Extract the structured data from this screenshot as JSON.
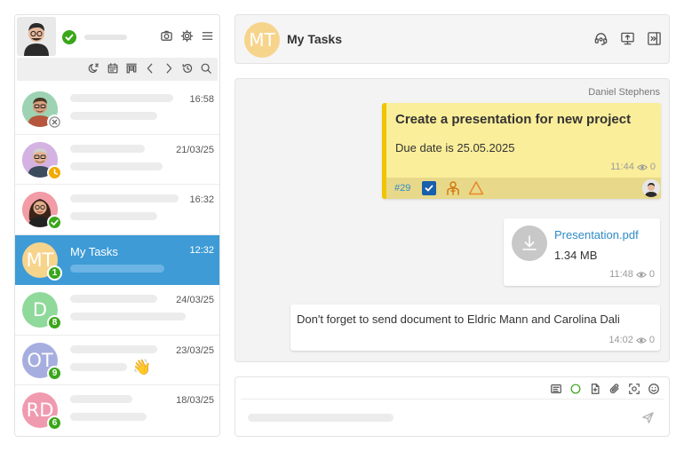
{
  "me": {
    "status_color": "#3aa61a"
  },
  "top_icons": [
    "camera-icon",
    "gear-icon",
    "menu-icon"
  ],
  "toolbar_icons": [
    "sleep-icon",
    "calendar-icon",
    "kanban-icon",
    "chevron-left-icon",
    "chevron-right-icon",
    "history-icon",
    "search-icon"
  ],
  "contacts": [
    {
      "time": "16:58",
      "badge_type": "close",
      "badge_color": "#8a8a8a",
      "badge": ""
    },
    {
      "time": "21/03/25",
      "badge_type": "clock",
      "badge_color": "#f2a900",
      "badge": ""
    },
    {
      "time": "16:32",
      "badge_type": "check",
      "badge_color": "#3aa61a",
      "badge": ""
    },
    {
      "initials": "MT",
      "name": "My Tasks",
      "time": "12:32",
      "badge": "1",
      "avatar_color": "#f7d48c",
      "badge_color": "#3aa61a",
      "active": true
    },
    {
      "initials": "D",
      "time": "24/03/25",
      "badge": "8",
      "avatar_color": "#8fd99b",
      "badge_color": "#3aa61a"
    },
    {
      "initials": "OT",
      "time": "23/03/25",
      "badge": "9",
      "avatar_color": "#a6aee0",
      "badge_color": "#3aa61a",
      "emoji": "👋"
    },
    {
      "initials": "RD",
      "time": "18/03/25",
      "badge": "6",
      "avatar_color": "#f09ab0",
      "badge_color": "#3aa61a"
    }
  ],
  "header": {
    "initials": "MT",
    "title": "My Tasks",
    "avatar_color": "#f7d48c",
    "icons": [
      "support-icon",
      "screen-share-icon",
      "panel-toggle-icon"
    ]
  },
  "chat": {
    "sender": "Daniel Stephens",
    "task": {
      "title": "Create a presentation for new project",
      "due": "Due date is 25.05.2025",
      "time": "11:44",
      "views": "0",
      "number": "#29",
      "bg_color": "#fbee9a",
      "accent_color": "#f1c400"
    },
    "file": {
      "name": "Presentation.pdf",
      "size": "1.34 MB",
      "time": "11:48",
      "views": "0"
    },
    "message": {
      "text": "Don't forget to send document to Eldric Mann and Carolina Dali",
      "time": "14:02",
      "views": "0"
    }
  },
  "composer": {
    "icons": [
      "template-icon",
      "status-circle-icon",
      "attach-document-icon",
      "paperclip-icon",
      "screenshot-icon",
      "emoji-icon"
    ],
    "send_icon": "send-icon"
  }
}
